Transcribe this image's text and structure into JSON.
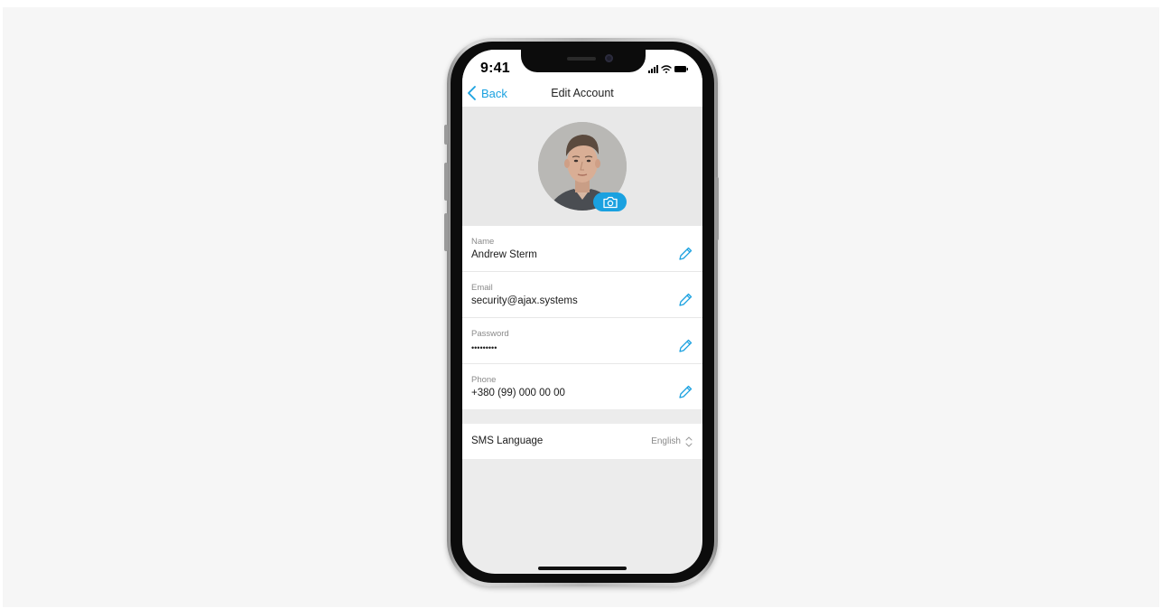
{
  "status_bar": {
    "time": "9:41",
    "signal_icon": "signal-bars-icon",
    "wifi_icon": "wifi-icon",
    "battery_icon": "battery-icon"
  },
  "nav": {
    "back_label": "Back",
    "title": "Edit Account"
  },
  "profile": {
    "avatar_icon": "user-photo",
    "camera_icon": "camera-icon"
  },
  "fields": [
    {
      "label": "Name",
      "value": "Andrew Sterm",
      "icon": "pencil-icon"
    },
    {
      "label": "Email",
      "value": "security@ajax.systems",
      "icon": "pencil-icon"
    },
    {
      "label": "Password",
      "value": "•••••••••",
      "icon": "pencil-icon"
    },
    {
      "label": "Phone",
      "value": "+380 (99) 000 00 00",
      "icon": "pencil-icon"
    }
  ],
  "sms_language": {
    "label": "SMS Language",
    "value": "English",
    "icon": "chevron-up-down-icon"
  },
  "colors": {
    "accent": "#1aa1e0",
    "background": "#f6f6f6",
    "screen_background": "#ececec"
  }
}
